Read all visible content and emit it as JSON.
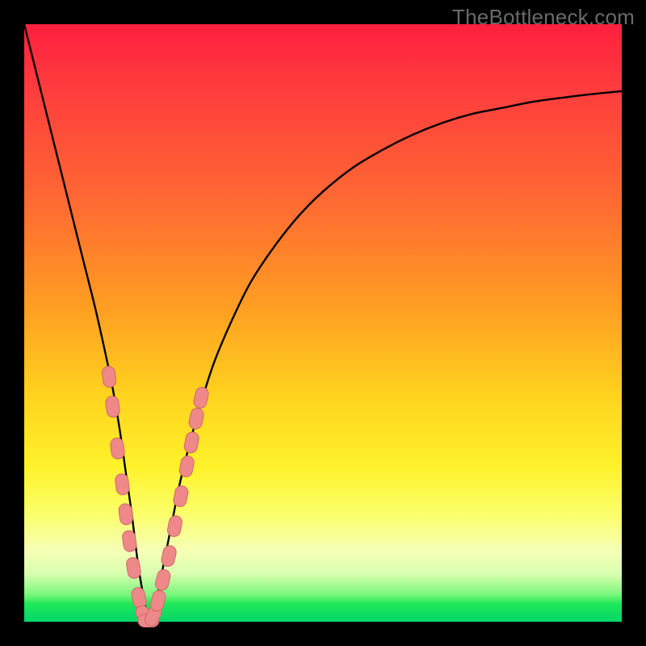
{
  "watermark": {
    "text": "TheBottleneck.com"
  },
  "colors": {
    "frame": "#000000",
    "curve": "#000000",
    "marker_fill": "#ef8888",
    "marker_stroke": "#cf6a6a"
  },
  "chart_data": {
    "type": "line",
    "title": "",
    "xlabel": "",
    "ylabel": "",
    "xlim": [
      0,
      100
    ],
    "ylim": [
      0,
      100
    ],
    "grid": false,
    "legend": false,
    "series": [
      {
        "name": "bottleneck-curve",
        "x": [
          0,
          2,
          4,
          6,
          8,
          10,
          12,
          14,
          15,
          16,
          17,
          18,
          19,
          20,
          21,
          22,
          23,
          24,
          25,
          26,
          28,
          30,
          32,
          35,
          38,
          42,
          46,
          50,
          55,
          60,
          65,
          70,
          75,
          80,
          85,
          90,
          95,
          100
        ],
        "y": [
          100,
          92,
          84,
          76,
          68,
          60,
          52,
          43,
          38,
          32,
          25,
          18,
          10,
          4,
          0,
          3,
          8,
          13,
          18,
          23,
          31,
          38,
          44,
          51,
          57,
          63,
          68,
          72,
          76,
          79,
          81.5,
          83.5,
          85,
          86,
          87,
          87.7,
          88.3,
          88.8
        ]
      }
    ],
    "markers": {
      "name": "highlighted-points",
      "indices_on_curve": true,
      "points": [
        {
          "x": 14.2,
          "y": 41
        },
        {
          "x": 14.8,
          "y": 36
        },
        {
          "x": 15.6,
          "y": 29
        },
        {
          "x": 16.4,
          "y": 23
        },
        {
          "x": 17.0,
          "y": 18
        },
        {
          "x": 17.6,
          "y": 13.5
        },
        {
          "x": 18.3,
          "y": 9
        },
        {
          "x": 19.2,
          "y": 4
        },
        {
          "x": 20.0,
          "y": 1
        },
        {
          "x": 20.8,
          "y": 0.2
        },
        {
          "x": 21.6,
          "y": 1.0
        },
        {
          "x": 22.4,
          "y": 3.5
        },
        {
          "x": 23.2,
          "y": 7
        },
        {
          "x": 24.2,
          "y": 11
        },
        {
          "x": 25.2,
          "y": 16
        },
        {
          "x": 26.2,
          "y": 21
        },
        {
          "x": 27.2,
          "y": 26
        },
        {
          "x": 28.0,
          "y": 30
        },
        {
          "x": 28.8,
          "y": 34
        },
        {
          "x": 29.6,
          "y": 37.5
        }
      ]
    }
  }
}
